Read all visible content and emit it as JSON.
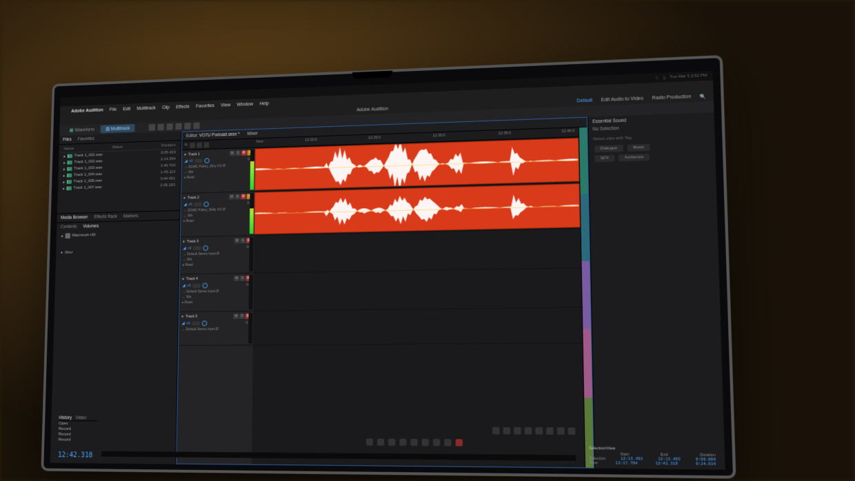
{
  "mac_menubar": {
    "time": "Tue Mar 5  2:52 PM"
  },
  "app": {
    "name": "Adobe Audition",
    "title_center": "Adobe Audition",
    "menus": [
      "File",
      "Edit",
      "Multitrack",
      "Clip",
      "Effects",
      "Favorites",
      "View",
      "Window",
      "Help"
    ],
    "workspace": {
      "default": "Default",
      "edit_video": "Edit Audio to Video",
      "radio": "Radio Production"
    },
    "search_placeholder": "Search Help"
  },
  "mode_tabs": {
    "waveform": "Waveform",
    "multitrack": "Multitrack"
  },
  "files_panel": {
    "tabs": [
      "Files",
      "Favorites"
    ],
    "columns": {
      "name": "Name",
      "status": "Status",
      "duration": "Duration"
    },
    "rows": [
      {
        "name": "Track 1_001.wav",
        "duration": "0:05.423"
      },
      {
        "name": "Track 1_002.wav",
        "duration": "2:14.394"
      },
      {
        "name": "Track 1_003.wav",
        "duration": "1:40.703"
      },
      {
        "name": "Track 1_004.wav",
        "duration": "1:45.113"
      },
      {
        "name": "Track 1_005.wav",
        "duration": "3:44.491"
      },
      {
        "name": "Track 1_007.wav",
        "duration": "2:39.183"
      }
    ]
  },
  "browser_panel": {
    "tabs": [
      "Media Browser",
      "Effects Rack",
      "Markers"
    ],
    "sub_tabs": [
      "Contents",
      "Volumes"
    ],
    "drive": "Macintosh HD",
    "shortcut": "Shor"
  },
  "editor": {
    "tab_prefix": "Editor:",
    "session": "VO7U Podcast.sesx *",
    "mixer": "Mixer",
    "ticks_label": "hms",
    "ticks": [
      "12:20.0",
      "12:25.0",
      "12:30.0",
      "12:35.0",
      "12:40.0"
    ],
    "fx_label": "fx"
  },
  "tracks": [
    {
      "name": "Track 1",
      "vol": "+0",
      "pan": "0.0",
      "input": "DGMC Pulley_Dirty VO",
      "mix": "Mix",
      "read": "Read",
      "msr": [
        "M",
        "S",
        "R",
        "I"
      ],
      "meter_pct": 70
    },
    {
      "name": "Track 2",
      "vol": "+0",
      "pan": "0.0",
      "input": "DGMC Pulley_Rolly VO",
      "mix": "Mix",
      "read": "Read",
      "msr": [
        "M",
        "S",
        "R",
        "I"
      ],
      "meter_pct": 62
    },
    {
      "name": "Track 3",
      "vol": "+0",
      "pan": "0.0",
      "input": "Default Stereo Input",
      "mix": "Mix",
      "read": "Read",
      "msr": [
        "M",
        "S",
        "R"
      ],
      "meter_pct": 0
    },
    {
      "name": "Track 4",
      "vol": "+0",
      "pan": "0.0",
      "input": "Default Stereo Input",
      "mix": "Mix",
      "read": "Read",
      "msr": [
        "M",
        "S",
        "R"
      ],
      "meter_pct": 0
    },
    {
      "name": "Track 5",
      "vol": "+0",
      "pan": "0.0",
      "input": "Default Stereo Input",
      "mix": "",
      "read": "",
      "msr": [
        "M",
        "S",
        "R"
      ],
      "meter_pct": 0
    }
  ],
  "essential_sound": {
    "title": "Essential Sound",
    "no_selection": "No Selection",
    "hint": "Select clips with Tag",
    "tags": [
      "Dialogue",
      "Music",
      "SFX",
      "Ambience"
    ]
  },
  "history": {
    "title": "History",
    "video": "Video",
    "items": [
      "Open",
      "Record",
      "Record",
      "Record"
    ]
  },
  "timecode": "12:42.318",
  "selection": {
    "title": "Selection/View",
    "labels": {
      "start": "Start",
      "end": "End",
      "duration": "Duration"
    },
    "sel": {
      "label": "Selection",
      "start": "12:13.493",
      "end": "12:13.493",
      "duration": "0:00.000"
    },
    "view": {
      "label": "View",
      "start": "12:17.704",
      "end": "12:42.318",
      "duration": "0:24.614"
    }
  },
  "colors": {
    "clip": "#d83a1a",
    "accent": "#4aa3ff"
  }
}
